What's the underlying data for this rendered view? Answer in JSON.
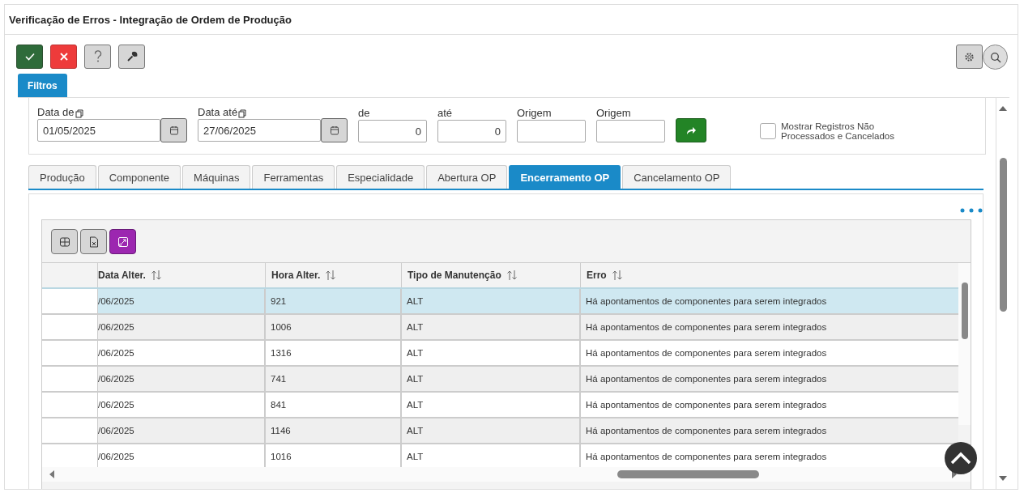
{
  "window": {
    "title": "Verificação de Erros - Integração de Ordem de Produção"
  },
  "toolbar": {
    "left": [
      {
        "kind": "confirm"
      },
      {
        "kind": "cancel"
      },
      {
        "kind": "help"
      },
      {
        "kind": "tools"
      }
    ],
    "right": [
      {
        "kind": "settings"
      },
      {
        "kind": "search"
      }
    ]
  },
  "filter_tab": {
    "label": "Filtros"
  },
  "filters": {
    "fields": [
      {
        "kind": "date",
        "label": "Data de",
        "value": "01/05/2025"
      },
      {
        "kind": "date",
        "label": "Data até",
        "value": "27/06/2025"
      },
      {
        "kind": "number",
        "label": "de",
        "value": "0"
      },
      {
        "kind": "number",
        "label": "até",
        "value": "0"
      },
      {
        "kind": "text",
        "label": "Origem"
      },
      {
        "kind": "text",
        "label": "Origem"
      }
    ],
    "checkbox": {
      "label": "Mostrar Registros Não Processados e Cancelados",
      "checked": false
    }
  },
  "tabs": [
    {
      "label": "Produção",
      "selected": false
    },
    {
      "label": "Componente",
      "selected": false
    },
    {
      "label": "Máquinas",
      "selected": false
    },
    {
      "label": "Ferramentas",
      "selected": false
    },
    {
      "label": "Especialidade",
      "selected": false
    },
    {
      "label": "Abertura OP",
      "selected": false
    },
    {
      "label": "Encerramento OP",
      "selected": true
    },
    {
      "label": "Cancelamento OP",
      "selected": false
    }
  ],
  "grid": {
    "tools": [
      {
        "kind": "columns"
      },
      {
        "kind": "excel"
      },
      {
        "kind": "expand"
      }
    ],
    "columns": [
      "Data Alter.",
      "Hora Alter.",
      "Tipo de Manutenção",
      "Erro"
    ],
    "rows": [
      {
        "selected": true,
        "cells": [
          "/06/2025",
          "921",
          "ALT",
          "Há apontamentos de componentes para serem integrados"
        ]
      },
      {
        "selected": false,
        "cells": [
          "/06/2025",
          "1006",
          "ALT",
          "Há apontamentos de componentes para serem integrados"
        ]
      },
      {
        "selected": false,
        "cells": [
          "/06/2025",
          "1316",
          "ALT",
          "Há apontamentos de componentes para serem integrados"
        ]
      },
      {
        "selected": false,
        "cells": [
          "/06/2025",
          "741",
          "ALT",
          "Há apontamentos de componentes para serem integrados"
        ]
      },
      {
        "selected": false,
        "cells": [
          "/06/2025",
          "841",
          "ALT",
          "Há apontamentos de componentes para serem integrados"
        ]
      },
      {
        "selected": false,
        "cells": [
          "/06/2025",
          "1146",
          "ALT",
          "Há apontamentos de componentes para serem integrados"
        ]
      },
      {
        "selected": false,
        "cells": [
          "/06/2025",
          "1016",
          "ALT",
          "Há apontamentos de componentes para serem integrados"
        ]
      }
    ]
  }
}
